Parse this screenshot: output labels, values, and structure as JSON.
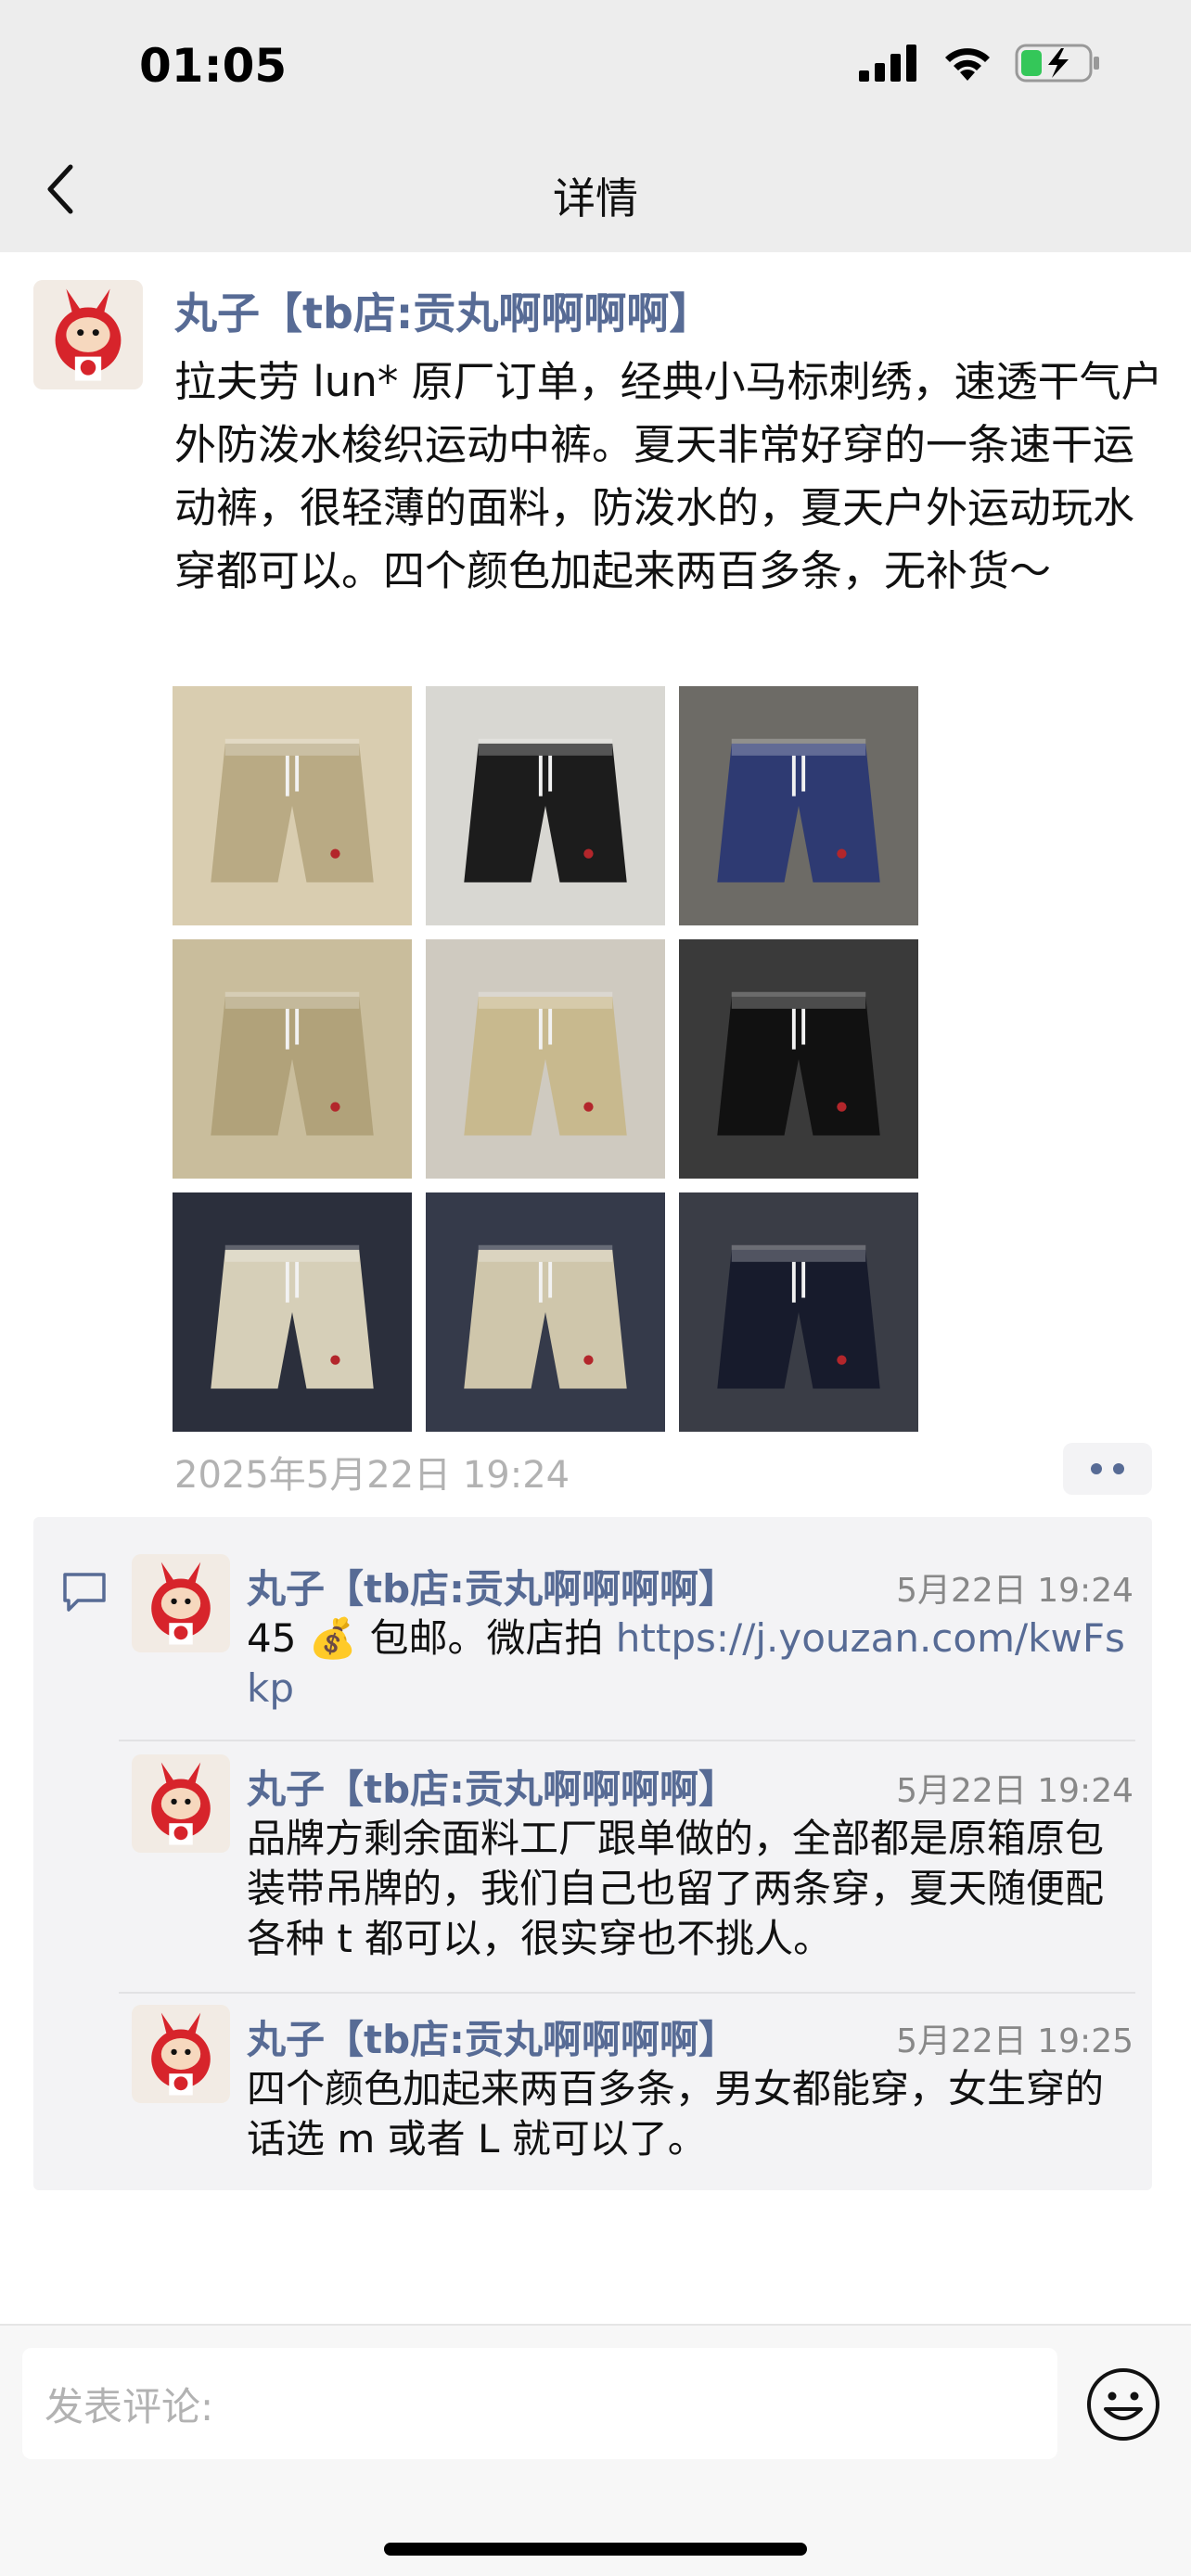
{
  "status_bar": {
    "time": "01:05",
    "icons": [
      "cellular-signal-icon",
      "wifi-icon",
      "battery-charging-icon"
    ]
  },
  "nav": {
    "title": "详情",
    "back_icon": "chevron-left-icon"
  },
  "post": {
    "author": "丸子【tb店:贡丸啊啊啊啊】",
    "text": "拉夫劳 lun* 原厂订单，经典小马标刺绣，速透干气户外防泼水梭织运动中裤。夏天非常好穿的一条速干运动裤，很轻薄的面料，防泼水的，夏天户外运动玩水穿都可以。四个颜色加起来两百多条，无补货～",
    "photos": [
      {
        "name": "photo-khaki-folded-shorts",
        "bg": "#d9cdb0",
        "main": "#b9aa84"
      },
      {
        "name": "photo-model-black-shorts",
        "bg": "#d8d7d2",
        "main": "#1c1c1c"
      },
      {
        "name": "photo-model-navy-shorts",
        "bg": "#6d6b66",
        "main": "#2e3a72"
      },
      {
        "name": "photo-khaki-shorts-tags",
        "bg": "#c9bd9c",
        "main": "#b1a27a"
      },
      {
        "name": "photo-shorts-rack",
        "bg": "#cfcac0",
        "main": "#c8b98e"
      },
      {
        "name": "photo-black-shorts-hanging",
        "bg": "#3a3a3a",
        "main": "#111111"
      },
      {
        "name": "photo-beige-shorts-hanging",
        "bg": "#2b2f3c",
        "main": "#d6cfb8"
      },
      {
        "name": "photo-beige-shorts-closeup",
        "bg": "#353a4a",
        "main": "#cfc6ab"
      },
      {
        "name": "photo-navy-shorts-hanging",
        "bg": "#3a3d46",
        "main": "#171b2c"
      }
    ],
    "time": "2025年5月22日 19:24"
  },
  "comments": [
    {
      "author": "丸子【tb店:贡丸啊啊啊啊】",
      "time": "5月22日 19:24",
      "text_before": "45 💰 包邮。微店拍 ",
      "link": "https://j.youzan.com/kwFskp"
    },
    {
      "author": "丸子【tb店:贡丸啊啊啊啊】",
      "time": "5月22日 19:24",
      "text": "品牌方剩余面料工厂跟单做的，全部都是原箱原包装带吊牌的，我们自己也留了两条穿，夏天随便配各种 t 都可以，很实穿也不挑人。"
    },
    {
      "author": "丸子【tb店:贡丸啊啊啊啊】",
      "time": "5月22日 19:25",
      "text": "四个颜色加起来两百多条，男女都能穿，女生穿的话选 m 或者 L 就可以了。"
    }
  ],
  "composer": {
    "placeholder": "发表评论:",
    "emoji_icon": "smiley-face-icon"
  },
  "colors": {
    "link_blue": "#576b95",
    "battery_green": "#34c759"
  }
}
